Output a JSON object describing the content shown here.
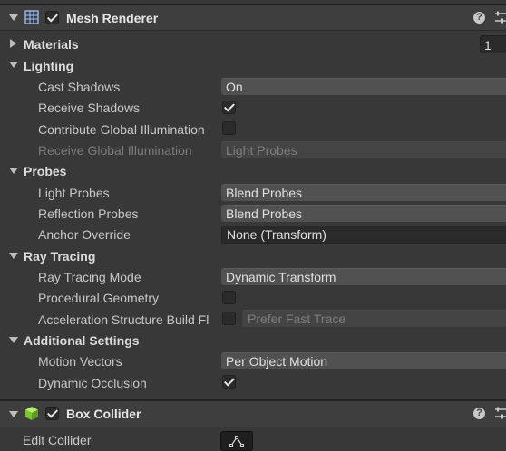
{
  "mesh_renderer": {
    "title": "Mesh Renderer",
    "enabled": true,
    "help_icon": "help-icon",
    "settings_icon": "sliders-icon",
    "materials": {
      "label": "Materials",
      "count": "1"
    },
    "lighting": {
      "label": "Lighting",
      "cast_shadows": {
        "label": "Cast Shadows",
        "value": "On"
      },
      "receive_shadows": {
        "label": "Receive Shadows",
        "checked": true
      },
      "contribute_gi": {
        "label": "Contribute Global Illumination",
        "checked": false
      },
      "receive_gi": {
        "label": "Receive Global Illumination",
        "value": "Light Probes"
      }
    },
    "probes": {
      "label": "Probes",
      "light_probes": {
        "label": "Light Probes",
        "value": "Blend Probes"
      },
      "reflection_probes": {
        "label": "Reflection Probes",
        "value": "Blend Probes"
      },
      "anchor_override": {
        "label": "Anchor Override",
        "value": "None (Transform)"
      }
    },
    "ray_tracing": {
      "label": "Ray Tracing",
      "mode": {
        "label": "Ray Tracing Mode",
        "value": "Dynamic Transform"
      },
      "procedural_geometry": {
        "label": "Procedural Geometry",
        "checked": false
      },
      "accel_build": {
        "label": "Acceleration Structure Build Fl",
        "value": "Prefer Fast Trace",
        "checked": false
      }
    },
    "additional": {
      "label": "Additional Settings",
      "motion_vectors": {
        "label": "Motion Vectors",
        "value": "Per Object Motion"
      },
      "dynamic_occlusion": {
        "label": "Dynamic Occlusion",
        "checked": true
      }
    }
  },
  "box_collider": {
    "title": "Box Collider",
    "enabled": true,
    "edit_collider": {
      "label": "Edit Collider",
      "icon": "edit-bounds-icon"
    }
  },
  "colors": {
    "background": "#383838",
    "header": "#3e3e3e",
    "dropdown": "#515151",
    "collider_icon": "#8fd43a"
  }
}
